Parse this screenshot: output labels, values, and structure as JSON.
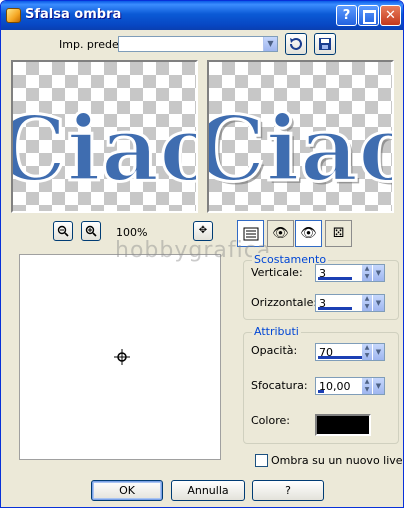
{
  "window": {
    "title": "Sfalsa ombra"
  },
  "preset": {
    "label": "Imp. predef.:",
    "value": ""
  },
  "preview": {
    "text": "Ciao"
  },
  "zoom": {
    "level": "100%"
  },
  "watermark": "hobbygrafica",
  "offset_group": {
    "title": "Scostamento",
    "vertical_label": "Verticale:",
    "vertical_value": "3",
    "horizontal_label": "Orizzontale:",
    "horizontal_value": "3"
  },
  "attributes_group": {
    "title": "Attributi",
    "opacity_label": "Opacità:",
    "opacity_value": "70",
    "blur_label": "Sfocatura:",
    "blur_value": "10,00",
    "color_label": "Colore:",
    "color_value": "#000000"
  },
  "new_layer_checkbox": {
    "label": "Ombra su un nuovo livello",
    "checked": false
  },
  "buttons": {
    "ok": "OK",
    "cancel": "Annulla",
    "help": "?"
  },
  "icons": {
    "help": "help-icon",
    "maximize": "maximize-icon",
    "close": "close-icon",
    "save_preset": "save-icon",
    "reset": "reset-icon",
    "zoom_out": "zoom-out-icon",
    "zoom_in": "zoom-in-icon",
    "pan": "move-icon",
    "auto_proof": "auto-proof-icon",
    "proof": "proof-eye-icon",
    "randomize": "dice-icon"
  }
}
